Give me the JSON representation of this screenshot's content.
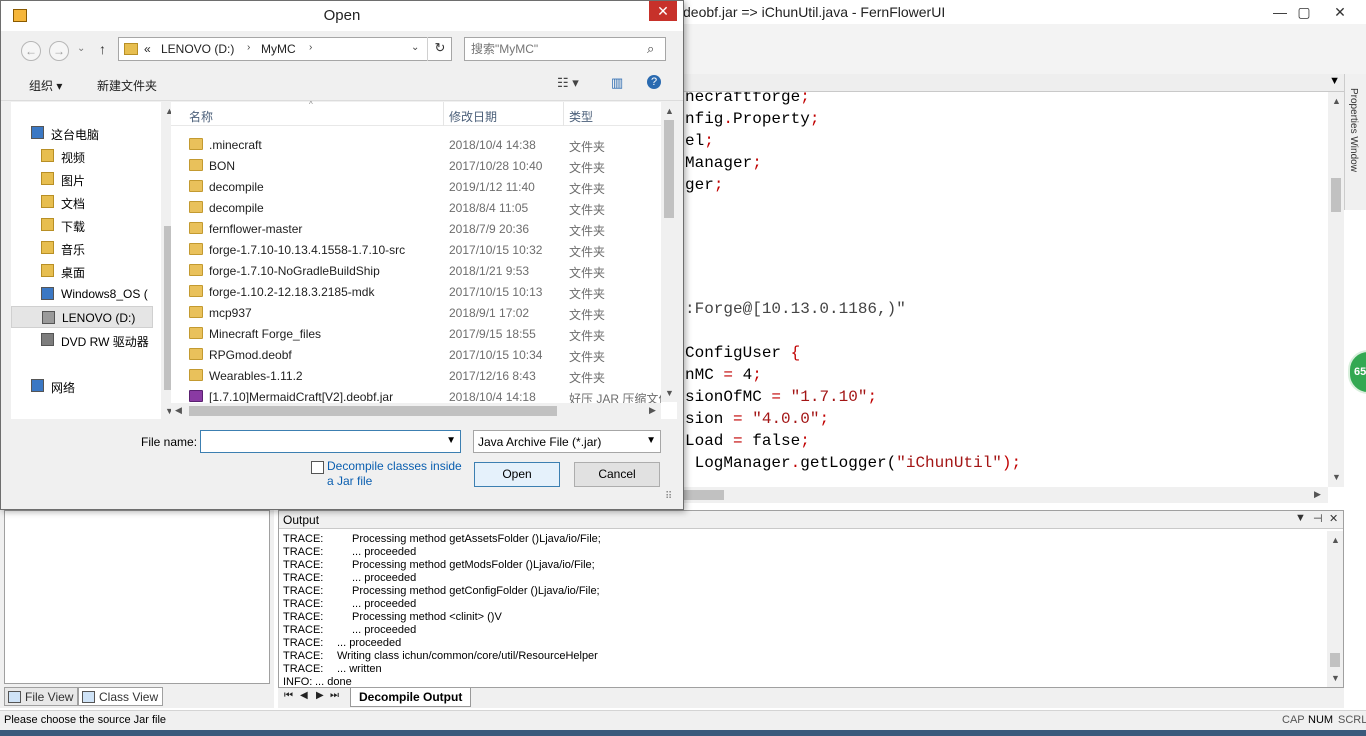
{
  "ide": {
    "title": "deobf.jar => iChunUtil.java - FernFlowerUI",
    "window_controls": [
      "—",
      "▢",
      "✕"
    ],
    "code_lines": [
      {
        "segs": [
          {
            "t": "necraftforge",
            "c": ""
          },
          {
            "t": ";",
            "c": "r"
          }
        ]
      },
      {
        "segs": [
          {
            "t": "nfig",
            "c": ""
          },
          {
            "t": ".",
            "c": "r"
          },
          {
            "t": "Property",
            "c": ""
          },
          {
            "t": ";",
            "c": "r"
          }
        ]
      },
      {
        "segs": [
          {
            "t": "el",
            "c": ""
          },
          {
            "t": ";",
            "c": "r"
          }
        ]
      },
      {
        "segs": [
          {
            "t": "Manager",
            "c": ""
          },
          {
            "t": ";",
            "c": "r"
          }
        ]
      },
      {
        "segs": [
          {
            "t": "ger",
            "c": ""
          },
          {
            "t": ";",
            "c": "r"
          }
        ]
      },
      {
        "segs": [
          {
            "t": ":Forge@[10.13.0.1186,)\"",
            "c": "g"
          }
        ]
      },
      {
        "segs": [
          {
            "t": "ConfigUser ",
            "c": ""
          },
          {
            "t": "{",
            "c": "r"
          }
        ]
      },
      {
        "segs": [
          {
            "t": "nMC ",
            "c": ""
          },
          {
            "t": "=",
            "c": "r"
          },
          {
            "t": " 4",
            "c": ""
          },
          {
            "t": ";",
            "c": "r"
          }
        ]
      },
      {
        "segs": [
          {
            "t": "sionOfMC ",
            "c": ""
          },
          {
            "t": "=",
            "c": "r"
          },
          {
            "t": " ",
            "c": ""
          },
          {
            "t": "\"1.7.10\"",
            "c": "s"
          },
          {
            "t": ";",
            "c": "r"
          }
        ]
      },
      {
        "segs": [
          {
            "t": "sion ",
            "c": ""
          },
          {
            "t": "=",
            "c": "r"
          },
          {
            "t": " ",
            "c": ""
          },
          {
            "t": "\"4.0.0\"",
            "c": "s"
          },
          {
            "t": ";",
            "c": "r"
          }
        ]
      },
      {
        "segs": [
          {
            "t": "Load ",
            "c": ""
          },
          {
            "t": "=",
            "c": "r"
          },
          {
            "t": " false",
            "c": ""
          },
          {
            "t": ";",
            "c": "r"
          }
        ]
      },
      {
        "segs": [
          {
            "t": " LogManager",
            "c": ""
          },
          {
            "t": ".",
            "c": "r"
          },
          {
            "t": "getLogger(",
            "c": ""
          },
          {
            "t": "\"iChunUtil\"",
            "c": "s"
          },
          {
            "t": ");",
            "c": "r"
          }
        ]
      }
    ],
    "properties_tab": "Properties Window",
    "badge": "65",
    "left_tabs": [
      "File View",
      "Class View"
    ],
    "output": {
      "title": "Output",
      "controls": [
        "▼",
        "⊣",
        "✕"
      ],
      "lines": [
        {
          "lv": "TRACE:",
          "msg": "Processing method getAssetsFolder ()Ljava/io/File;",
          "indent": 2
        },
        {
          "lv": "TRACE:",
          "msg": "... proceeded",
          "indent": 2
        },
        {
          "lv": "TRACE:",
          "msg": "Processing method getModsFolder ()Ljava/io/File;",
          "indent": 2
        },
        {
          "lv": "TRACE:",
          "msg": "... proceeded",
          "indent": 2
        },
        {
          "lv": "TRACE:",
          "msg": "Processing method getConfigFolder ()Ljava/io/File;",
          "indent": 2
        },
        {
          "lv": "TRACE:",
          "msg": "... proceeded",
          "indent": 2
        },
        {
          "lv": "TRACE:",
          "msg": "Processing method <clinit> ()V",
          "indent": 2
        },
        {
          "lv": "TRACE:",
          "msg": "... proceeded",
          "indent": 2
        },
        {
          "lv": "TRACE:",
          "msg": "... proceeded",
          "indent": 1
        },
        {
          "lv": "TRACE:",
          "msg": "Writing class ichun/common/core/util/ResourceHelper",
          "indent": 1
        },
        {
          "lv": "TRACE:",
          "msg": "... written",
          "indent": 1
        },
        {
          "lv": "INFO:",
          "msg": "... done",
          "indent": 0
        }
      ],
      "tab": "Decompile Output",
      "nav": [
        "⏮",
        "◀",
        "▶",
        "⏭"
      ]
    },
    "status": {
      "message": "Please choose the source Jar file",
      "indicators": [
        "CAP",
        "NUM",
        "SCRL"
      ]
    }
  },
  "dialog": {
    "title": "Open",
    "close": "✕",
    "nav": {
      "back": "←",
      "forward": "→",
      "recent": "⌄",
      "up": "↑"
    },
    "address": {
      "prefix": "«",
      "crumbs": [
        "LENOVO (D:)",
        "MyMC"
      ],
      "refresh": "↻"
    },
    "search_placeholder": "搜索\"MyMC\"",
    "commands": {
      "organize": "组织 ▾",
      "new_folder": "新建文件夹"
    },
    "nav_items": [
      {
        "label": "这台电脑",
        "icon": "computer-icon",
        "level": 0
      },
      {
        "label": "视频",
        "icon": "videos-folder-icon",
        "level": 1
      },
      {
        "label": "图片",
        "icon": "pictures-folder-icon",
        "level": 1
      },
      {
        "label": "文档",
        "icon": "documents-folder-icon",
        "level": 1
      },
      {
        "label": "下载",
        "icon": "downloads-folder-icon",
        "level": 1
      },
      {
        "label": "音乐",
        "icon": "music-folder-icon",
        "level": 1
      },
      {
        "label": "桌面",
        "icon": "desktop-folder-icon",
        "level": 1
      },
      {
        "label": "Windows8_OS (",
        "icon": "windows-drive-icon",
        "level": 1
      },
      {
        "label": "LENOVO (D:)",
        "icon": "drive-icon",
        "level": 1
      },
      {
        "label": "DVD RW 驱动器",
        "icon": "dvd-drive-icon",
        "level": 1
      },
      {
        "label": "网络",
        "icon": "network-icon",
        "level": 0
      }
    ],
    "columns": {
      "name": "名称",
      "date": "修改日期",
      "type": "类型"
    },
    "files": [
      {
        "name": ".minecraft",
        "date": "2018/10/4 14:38",
        "type": "文件夹",
        "kind": "folder"
      },
      {
        "name": "BON",
        "date": "2017/10/28 10:40",
        "type": "文件夹",
        "kind": "folder"
      },
      {
        "name": "decompile",
        "date": "2019/1/12 11:40",
        "type": "文件夹",
        "kind": "folder"
      },
      {
        "name": "decompile",
        "date": "2018/8/4 11:05",
        "type": "文件夹",
        "kind": "folder"
      },
      {
        "name": "fernflower-master",
        "date": "2018/7/9 20:36",
        "type": "文件夹",
        "kind": "folder"
      },
      {
        "name": "forge-1.7.10-10.13.4.1558-1.7.10-src",
        "date": "2017/10/15 10:32",
        "type": "文件夹",
        "kind": "folder"
      },
      {
        "name": "forge-1.7.10-NoGradleBuildShip",
        "date": "2018/1/21 9:53",
        "type": "文件夹",
        "kind": "folder"
      },
      {
        "name": "forge-1.10.2-12.18.3.2185-mdk",
        "date": "2017/10/15 10:13",
        "type": "文件夹",
        "kind": "folder"
      },
      {
        "name": "mcp937",
        "date": "2018/9/1 17:02",
        "type": "文件夹",
        "kind": "folder"
      },
      {
        "name": "Minecraft Forge_files",
        "date": "2017/9/15 18:55",
        "type": "文件夹",
        "kind": "folder"
      },
      {
        "name": "RPGmod.deobf",
        "date": "2017/10/15 10:34",
        "type": "文件夹",
        "kind": "folder"
      },
      {
        "name": "Wearables-1.11.2",
        "date": "2017/12/16 8:43",
        "type": "文件夹",
        "kind": "folder"
      },
      {
        "name": "[1.7.10]MermaidCraft[V2].deobf.jar",
        "date": "2018/10/4 14:18",
        "type": "好压 JAR 压缩文件",
        "kind": "jar"
      }
    ],
    "file_name_label": "File name:",
    "file_name_value": "",
    "file_type": "Java Archive File (*.jar)",
    "checkbox_label": "Decompile classes inside a Jar file",
    "checkbox_checked": false,
    "open_button": "Open",
    "cancel_button": "Cancel"
  }
}
